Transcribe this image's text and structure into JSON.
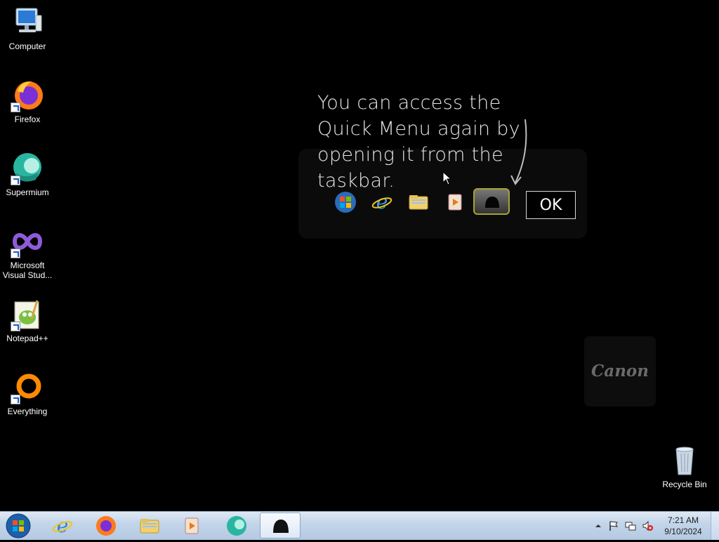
{
  "desktop": {
    "icons": [
      {
        "label": "Computer",
        "icon": "computer-icon"
      },
      {
        "label": "Firefox",
        "icon": "firefox-icon"
      },
      {
        "label": "Supermium",
        "icon": "supermium-icon"
      },
      {
        "label": "Microsoft Visual Stud...",
        "icon": "visual-studio-icon"
      },
      {
        "label": "Notepad++",
        "icon": "notepadpp-icon"
      },
      {
        "label": "Everything",
        "icon": "everything-icon"
      },
      {
        "label": "Recycle Bin",
        "icon": "recycle-bin-icon"
      }
    ]
  },
  "quick_menu_tip": {
    "message": "You can access the Quick Menu again by opening it from the taskbar.",
    "ok_label": "OK",
    "taskbar_preview_icons": [
      "windows-start-icon",
      "internet-explorer-icon",
      "file-explorer-icon",
      "media-player-icon",
      "quick-menu-icon"
    ]
  },
  "canon_widget": {
    "logo_text": "Canon"
  },
  "taskbar": {
    "pinned": [
      "internet-explorer-icon",
      "firefox-icon",
      "file-explorer-icon",
      "media-player-icon",
      "supermium-icon",
      "quick-menu-icon"
    ],
    "active_item": "quick-menu-icon",
    "tray_icons": [
      "show-hidden-icons",
      "action-center-flag-icon",
      "network-icon",
      "volume-muted-icon"
    ],
    "clock": {
      "time": "7:21 AM",
      "date": "9/10/2024"
    }
  },
  "colors": {
    "desktop_background": "#000000",
    "taskbar_top": "#dfe9f5",
    "highlight_border": "#a9a330"
  }
}
